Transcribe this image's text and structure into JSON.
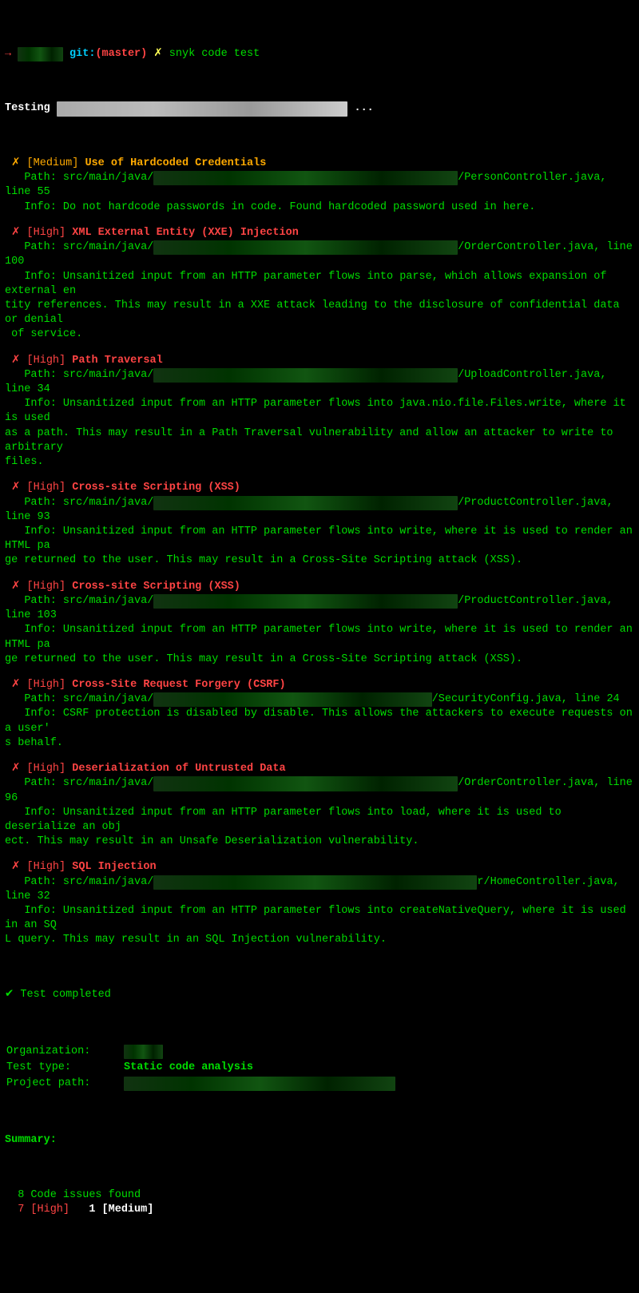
{
  "prompt": {
    "arrow": "→",
    "dir_hidden": "project",
    "git_label": "git:",
    "branch": "(master)",
    "sep": "✗",
    "command": "snyk code test"
  },
  "testing_label": "Testing ",
  "testing_path_hidden": "xxxxxxxxxxxxxxxxxxxxxxxxxxxxxxxxxxxxxxxxxxxxx",
  "testing_dots": " ...",
  "path_label": "Path: ",
  "info_label": "Info: ",
  "findings": [
    {
      "sev": "[Medium]",
      "sev_class": "orange",
      "title": "Use of Hardcoded Credentials",
      "path_prefix": "src/main/java/",
      "path_hidden": "xxxxxxxxxxxxxxxxxxxxxxxxxxxxxxxxxxxxxxxxxxxxxxx",
      "path_suffix": "/PersonController.java, line 55",
      "info": "Do not hardcode passwords in code. Found hardcoded password used in here."
    },
    {
      "sev": "[High]",
      "sev_class": "red",
      "title": "XML External Entity (XXE) Injection",
      "path_prefix": "src/main/java/",
      "path_hidden": "xxxxxxxxxxxxxxxxxxxxxxxxxxxxxxxxxxxxxxxxxxxxxxx",
      "path_suffix": "/OrderController.java, line 100",
      "info": "Unsanitized input from an HTTP parameter flows into parse, which allows expansion of external en\ntity references. This may result in a XXE attack leading to the disclosure of confidential data or denial\n of service."
    },
    {
      "sev": "[High]",
      "sev_class": "red",
      "title": "Path Traversal",
      "path_prefix": "src/main/java/",
      "path_hidden": "xxxxxxxxxxxxxxxxxxxxxxxxxxxxxxxxxxxxxxxxxxxxxxx",
      "path_suffix": "/UploadController.java, line 34",
      "info": "Unsanitized input from an HTTP parameter flows into java.nio.file.Files.write, where it is used \nas a path. This may result in a Path Traversal vulnerability and allow an attacker to write to arbitrary \nfiles."
    },
    {
      "sev": "[High]",
      "sev_class": "red",
      "title": "Cross-site Scripting (XSS)",
      "path_prefix": "src/main/java/",
      "path_hidden": "xxxxxxxxxxxxxxxxxxxxxxxxxxxxxxxxxxxxxxxxxxxxxxx",
      "path_suffix": "/ProductController.java, line 93",
      "info": "Unsanitized input from an HTTP parameter flows into write, where it is used to render an HTML pa\nge returned to the user. This may result in a Cross-Site Scripting attack (XSS)."
    },
    {
      "sev": "[High]",
      "sev_class": "red",
      "title": "Cross-site Scripting (XSS)",
      "path_prefix": "src/main/java/",
      "path_hidden": "xxxxxxxxxxxxxxxxxxxxxxxxxxxxxxxxxxxxxxxxxxxxxxx",
      "path_suffix": "/ProductController.java, line 103",
      "info": "Unsanitized input from an HTTP parameter flows into write, where it is used to render an HTML pa\nge returned to the user. This may result in a Cross-Site Scripting attack (XSS)."
    },
    {
      "sev": "[High]",
      "sev_class": "red",
      "title": "Cross-Site Request Forgery (CSRF)",
      "path_prefix": "src/main/java/",
      "path_hidden": "xxxxxxxxxxxxxxxxxxxxxxxxxxxxxxxxxxxxxxxxxxx",
      "path_suffix": "/SecurityConfig.java, line 24",
      "info": "CSRF protection is disabled by disable. This allows the attackers to execute requests on a user'\ns behalf."
    },
    {
      "sev": "[High]",
      "sev_class": "red",
      "title": "Deserialization of Untrusted Data",
      "path_prefix": "src/main/java/",
      "path_hidden": "xxxxxxxxxxxxxxxxxxxxxxxxxxxxxxxxxxxxxxxxxxxxxxx",
      "path_suffix": "/OrderController.java, line 96",
      "info": "Unsanitized input from an HTTP parameter flows into load, where it is used to deserialize an obj\nect. This may result in an Unsafe Deserialization vulnerability."
    },
    {
      "sev": "[High]",
      "sev_class": "red",
      "title": "SQL Injection",
      "path_prefix": "src/main/java/",
      "path_hidden": "xxxxxxxxxxxxxxxxxxxxxxxxxxxxxxxxxxxxxxxxxxxxxxxxxx",
      "path_suffix": "r/HomeController.java, line 32",
      "info": "Unsanitized input from an HTTP parameter flows into createNativeQuery, where it is used in an SQ\nL query. This may result in an SQL Injection vulnerability."
    }
  ],
  "completed_check": "✔",
  "completed": " Test completed",
  "summary_rows": [
    {
      "label": "Organization:",
      "value_hidden": "xxxxxx"
    },
    {
      "label": "Test type:",
      "value": "Static code analysis"
    },
    {
      "label": "Project path:",
      "value_hidden": "xxxxxxxxxxxxxxxxxxxxxxxxxxxxxxxxxxxxxxxxxx"
    }
  ],
  "summary_header": "Summary:",
  "issues_found": "  8 Code issues found",
  "severity_counts": {
    "high": "  7 [High]",
    "medium": "   1 [Medium]"
  }
}
